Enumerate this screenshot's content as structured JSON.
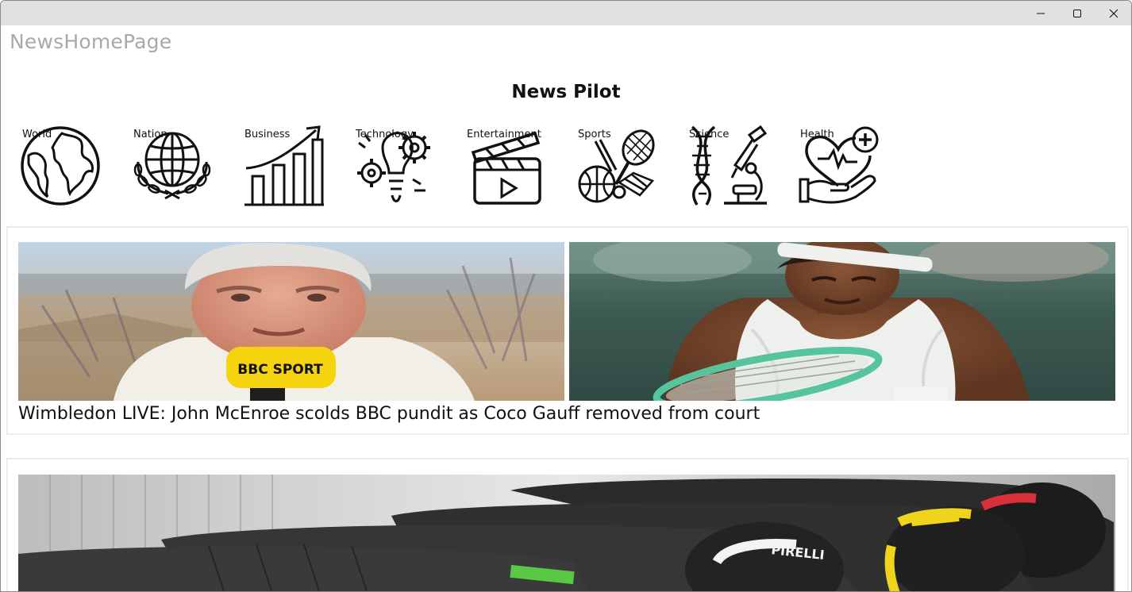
{
  "window": {
    "minimize_label": "Minimize",
    "maximize_label": "Maximize",
    "close_label": "Close"
  },
  "app": {
    "title": "NewsHomePage",
    "brand": "News Pilot"
  },
  "categories": [
    {
      "label": "World",
      "icon": "globe-icon"
    },
    {
      "label": "Nation",
      "icon": "globe-laurel-icon"
    },
    {
      "label": "Business",
      "icon": "bar-chart-growth-icon"
    },
    {
      "label": "Technology",
      "icon": "lightbulb-gears-icon"
    },
    {
      "label": "Entertainment",
      "icon": "clapperboard-icon"
    },
    {
      "label": "Sports",
      "icon": "sports-balls-icon"
    },
    {
      "label": "Science",
      "icon": "dna-microscope-icon"
    },
    {
      "label": "Health",
      "icon": "heart-hand-icon"
    }
  ],
  "articles": [
    {
      "headline": "Wimbledon LIVE: John McEnroe scolds BBC pundit as Coco Gauff removed from court",
      "images": [
        {
          "name": "pundit-interview-photo",
          "microphone_text": "BBC SPORT"
        },
        {
          "name": "tennis-player-photo"
        }
      ]
    },
    {
      "headline": "",
      "images": [
        {
          "name": "racing-tyres-photo",
          "tyre_text": "PIRELLI"
        }
      ]
    }
  ]
}
